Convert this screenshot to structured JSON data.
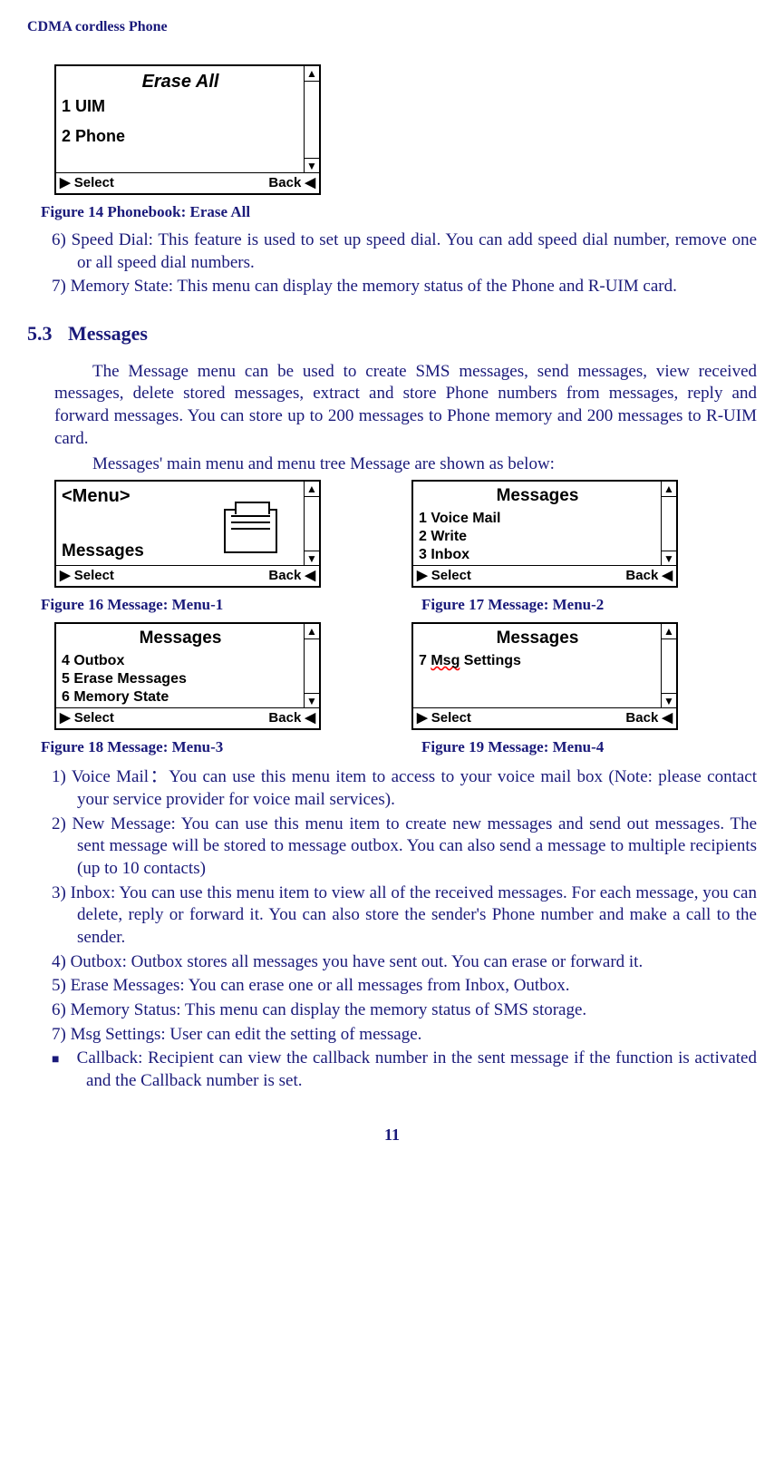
{
  "header": "CDMA cordless Phone",
  "fig14": {
    "title": "Erase All",
    "item1": "1 UIM",
    "item2": "2 Phone",
    "select": "Select",
    "back": "Back",
    "caption": "Figure 14 Phonebook: Erase All"
  },
  "list1": {
    "i6": "6)  Speed Dial: This feature is used to set up speed dial. You can add speed dial number, remove one or all speed dial numbers.",
    "i7": "7)  Memory State: This menu can display the memory status of the Phone and R-UIM card."
  },
  "sect": {
    "num": "5.3",
    "title": "Messages"
  },
  "para1": "The Message menu can be used to create SMS messages, send messages, view received messages, delete stored messages, extract and store Phone numbers from messages, reply and forward messages. You can store up to 200 messages to Phone memory and 200 messages to R-UIM card.",
  "para2": "Messages' main menu and menu tree Message are shown as below:",
  "fig16": {
    "menu": "<Menu>",
    "label": "Messages",
    "select": "Select",
    "back": "Back",
    "caption": "Figure 16 Message: Menu-1"
  },
  "fig17": {
    "title": "Messages",
    "i1": "1 Voice Mail",
    "i2p": "2 ",
    "i2w": "Write",
    "i3": "3 Inbox",
    "select": "Select",
    "back": "Back",
    "caption": "Figure 17 Message: Menu-2"
  },
  "fig18": {
    "title": "Messages",
    "i4": "4 Outbox",
    "i5": "5 Erase Messages",
    "i6": "6 Memory State",
    "select": "Select",
    "back": "Back",
    "caption": "Figure 18 Message: Menu-3"
  },
  "fig19": {
    "title": "Messages",
    "i7p": "7 ",
    "i7w": "Msg",
    "i7s": " Settings",
    "select": "Select",
    "back": "Back",
    "caption": "Figure 19 Message: Menu-4"
  },
  "list2": {
    "i1": "1)  Voice Mail：You can use this menu item to access to your voice mail box (Note: please contact your service provider for voice mail services).",
    "i2": "2)  New Message: You can use this menu item to create new messages and send out messages. The sent message will be stored to message outbox. You can also send a message to multiple  recipients (up to 10 contacts)",
    "i3": "3)  Inbox: You can use this menu item to view all of the received messages. For each message, you can delete, reply or forward it. You can also store the sender's Phone number and make a call to the sender.",
    "i4": "4)  Outbox: Outbox stores all messages you have sent out. You can erase or forward it.",
    "i5": "5)  Erase Messages: You can erase one or all messages from Inbox, Outbox.",
    "i6": "6)  Memory Status: This menu can display the memory status of SMS storage.",
    "i7": "7)  Msg Settings: User can edit the setting of message.",
    "b1": "Callback: Recipient can view the callback number in the sent message if the function is activated and  the Callback number is set."
  },
  "pagenum": "11",
  "glyph": {
    "square": "■",
    "tri_r": "▶",
    "tri_l": "◀",
    "arrow_up": "▲",
    "arrow_down": "▼"
  }
}
